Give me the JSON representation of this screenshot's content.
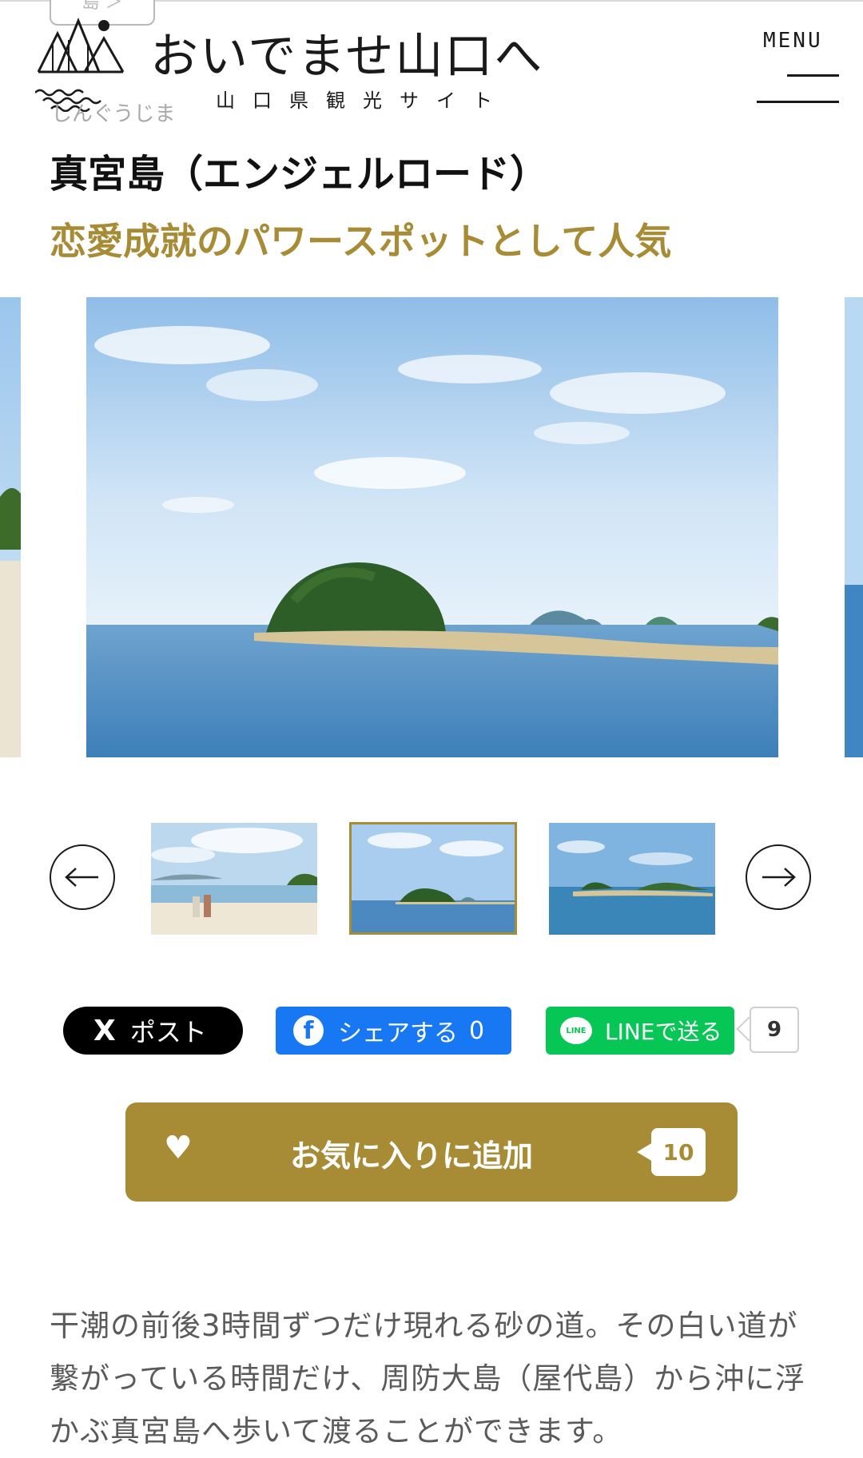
{
  "header": {
    "category_chip": "島 ＞",
    "logo_title": "おいでませ山口へ",
    "logo_subtitle": "山口県観光サイト",
    "reading": "しんぐうじま",
    "menu_label": "MENU"
  },
  "spot": {
    "title": "真宮島（エンジェルロード）",
    "subtitle": "恋愛成就のパワースポットとして人気"
  },
  "gallery": {
    "selected_index": 1,
    "thumbnail_count": 3
  },
  "share": {
    "x_label": "ポスト",
    "x_glyph": "X",
    "facebook_label": "シェアする",
    "facebook_count": "0",
    "facebook_glyph": "f",
    "line_label": "LINEで送る",
    "line_glyph": "LINE",
    "line_count": "9"
  },
  "favorite": {
    "label": "お気に入りに追加",
    "count": "10",
    "heart": "♥"
  },
  "description": "干潮の前後3時間ずつだけ現れる砂の道。その白い道が繋がっている時間だけ、周防大島（屋代島）から沖に浮かぶ真宮島へ歩いて渡ることができます。",
  "colors": {
    "accent_gold": "#a78b35",
    "x_black": "#000000",
    "facebook_blue": "#1877f2",
    "line_green": "#06c755"
  }
}
